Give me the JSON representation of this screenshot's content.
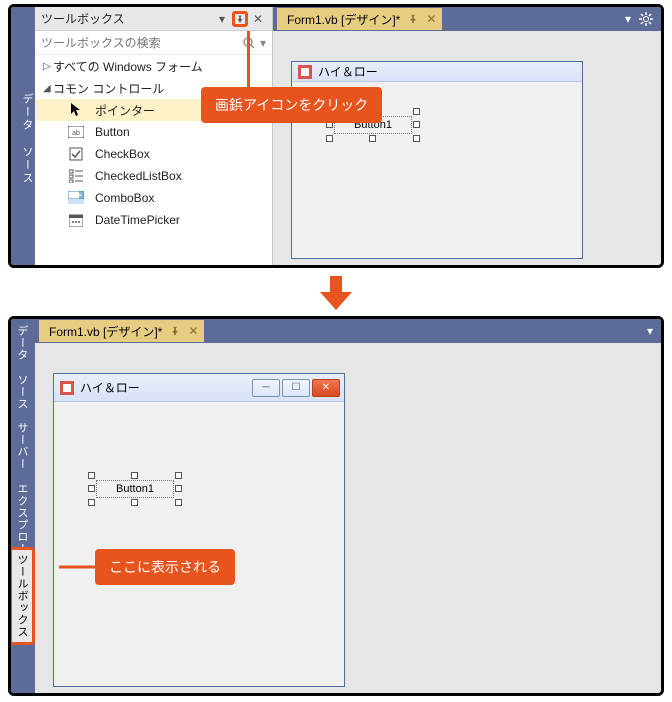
{
  "top": {
    "left_tab": "データ ソース",
    "toolbox": {
      "title": "ツールボックス",
      "search_placeholder": "ツールボックスの検索",
      "cat1": "すべての Windows フォーム",
      "cat2": "コモン コントロール",
      "items": [
        {
          "label": "ポインター"
        },
        {
          "label": "Button"
        },
        {
          "label": "CheckBox"
        },
        {
          "label": "CheckedListBox"
        },
        {
          "label": "ComboBox"
        },
        {
          "label": "DateTimePicker"
        }
      ]
    },
    "doc_tab": "Form1.vb [デザイン]*",
    "form_title": "ハイ＆ロー",
    "button_text": "Button1",
    "callout": "画鋲アイコンをクリック"
  },
  "bottom": {
    "left_tabs": [
      "データ ソース",
      "サーバー エクスプローラー",
      "ツールボックス"
    ],
    "doc_tab": "Form1.vb [デザイン]*",
    "form_title": "ハイ＆ロー",
    "button_text": "Button1",
    "callout": "ここに表示される"
  }
}
